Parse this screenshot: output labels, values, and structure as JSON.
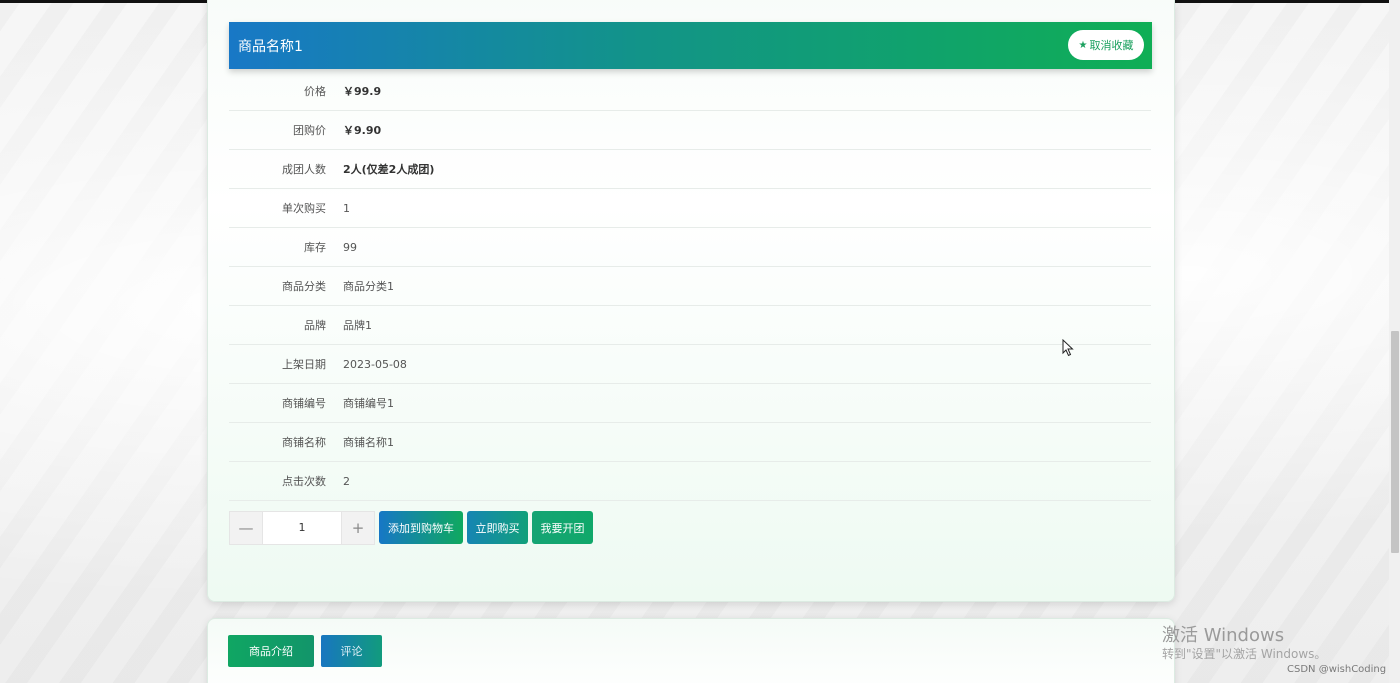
{
  "product": {
    "title": "商品名称1",
    "favorite_button": "取消收藏",
    "favorite_icon": "star-icon"
  },
  "details": [
    {
      "label": "价格",
      "value": "￥99.9",
      "bold": true
    },
    {
      "label": "团购价",
      "value": "￥9.90",
      "bold": true
    },
    {
      "label": "成团人数",
      "value": "2人(仅差2人成团)",
      "bold": true
    },
    {
      "label": "单次购买",
      "value": "1",
      "bold": false
    },
    {
      "label": "库存",
      "value": "99",
      "bold": false
    },
    {
      "label": "商品分类",
      "value": "商品分类1",
      "bold": false
    },
    {
      "label": "品牌",
      "value": "品牌1",
      "bold": false
    },
    {
      "label": "上架日期",
      "value": "2023-05-08",
      "bold": false
    },
    {
      "label": "商铺编号",
      "value": "商铺编号1",
      "bold": false
    },
    {
      "label": "商铺名称",
      "value": "商铺名称1",
      "bold": false
    },
    {
      "label": "点击次数",
      "value": "2",
      "bold": false
    }
  ],
  "quantity": {
    "minus": "—",
    "value": "1",
    "plus": "+"
  },
  "actions": {
    "add_to_cart": "添加到购物车",
    "buy_now": "立即购买",
    "start_group": "我要开团"
  },
  "tabs": {
    "intro": "商品介绍",
    "comments": "评论"
  },
  "overlay": {
    "windows_title": "激活 Windows",
    "windows_sub": "转到\"设置\"以激活 Windows。",
    "csdn": "CSDN @wishCoding"
  },
  "colors": {
    "gradient_start": "#1878c6",
    "gradient_end": "#0fae55"
  }
}
